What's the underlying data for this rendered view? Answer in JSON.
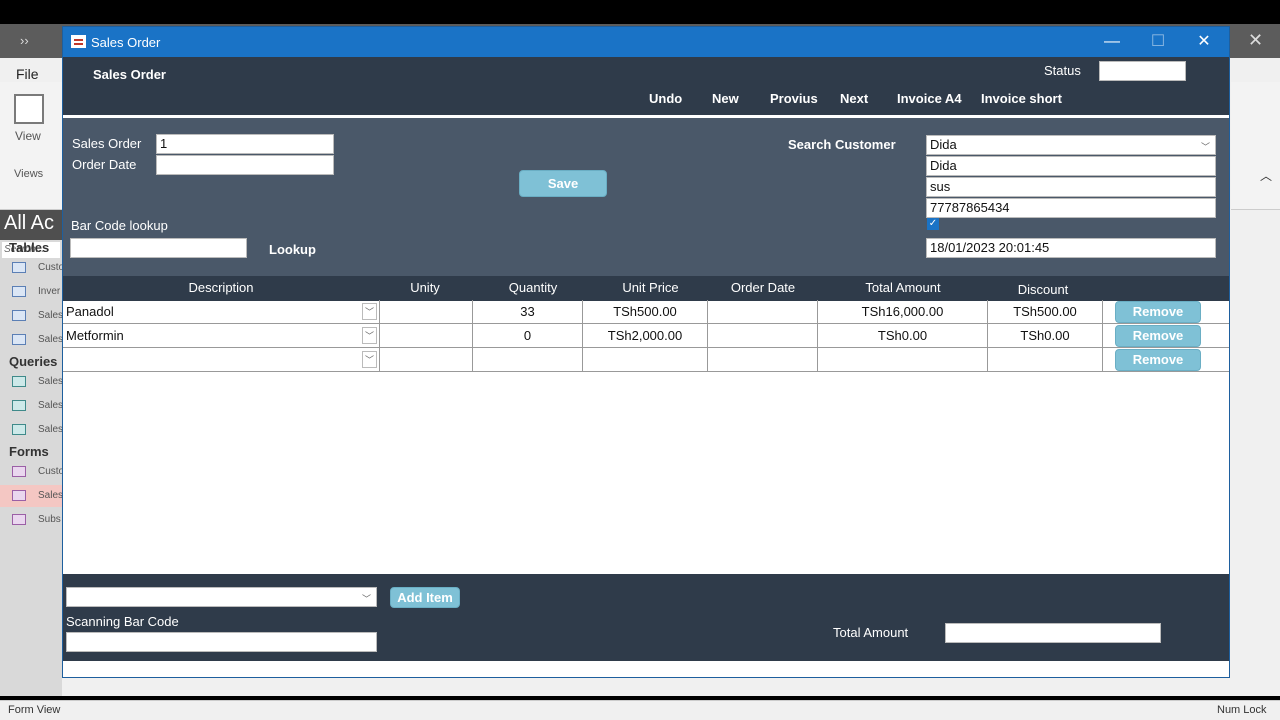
{
  "access": {
    "file_tab": "File",
    "view_label": "View",
    "views_group": "Views",
    "nav_title": "All Ac",
    "nav_search": "Search...",
    "sections": {
      "tables": "Tables",
      "queries": "Queries",
      "forms": "Forms"
    },
    "tables": [
      "Custo",
      "Inver",
      "Sales",
      "Sales"
    ],
    "queries": [
      "Sales",
      "Sales",
      "Sales"
    ],
    "forms": [
      "Custo",
      "Sales",
      "Subs"
    ],
    "status_left": "Form View",
    "status_right": "Num Lock"
  },
  "window": {
    "title": "Sales Order",
    "min": "—",
    "max": "☐",
    "close": "✕"
  },
  "header": {
    "form_title": "Sales Order",
    "status_label": "Status",
    "status_value": "",
    "nav": {
      "undo": "Undo",
      "new": "New",
      "previous": "Provius",
      "next": "Next",
      "invoice_a4": "Invoice A4",
      "invoice_short": "Invoice short"
    }
  },
  "detail": {
    "sales_order_label": "Sales Order",
    "sales_order_value": "1",
    "order_date_label": "Order Date",
    "order_date_value": "",
    "save": "Save",
    "barcode_label": "Bar Code lookup",
    "barcode_value": "",
    "lookup": "Lookup",
    "search_customer_label": "Search Customer",
    "customer_select": "Dida",
    "customer_name": "Dida",
    "customer_field2": "sus",
    "customer_phone": "77787865434",
    "customer_checked": true,
    "datetime": "18/01/2023 20:01:45"
  },
  "grid": {
    "headers": {
      "description": "Description",
      "unity": "Unity",
      "quantity": "Quantity",
      "unit_price": "Unit Price",
      "order_date": "Order Date",
      "total_amount": "Total Amount",
      "discount": "Discount"
    },
    "remove": "Remove",
    "rows": [
      {
        "description": "Panadol",
        "unity": "",
        "quantity": "33",
        "unit_price": "TSh500.00",
        "order_date": "",
        "total": "TSh16,000.00",
        "discount": "TSh500.00"
      },
      {
        "description": "Metformin",
        "unity": "",
        "quantity": "0",
        "unit_price": "TSh2,000.00",
        "order_date": "",
        "total": "TSh0.00",
        "discount": "TSh0.00"
      },
      {
        "description": "",
        "unity": "",
        "quantity": "",
        "unit_price": "",
        "order_date": "",
        "total": "",
        "discount": ""
      }
    ]
  },
  "footer": {
    "product_select": "",
    "add_item": "Add Item",
    "scanning_label": "Scanning Bar Code",
    "scanning_value": "",
    "total_label": "Total Amount",
    "total_value": ""
  },
  "colors": {
    "titlebar": "#1a73c6",
    "header": "#2f3b4a",
    "detail": "#4a5869",
    "button": "#7fc1d6"
  }
}
